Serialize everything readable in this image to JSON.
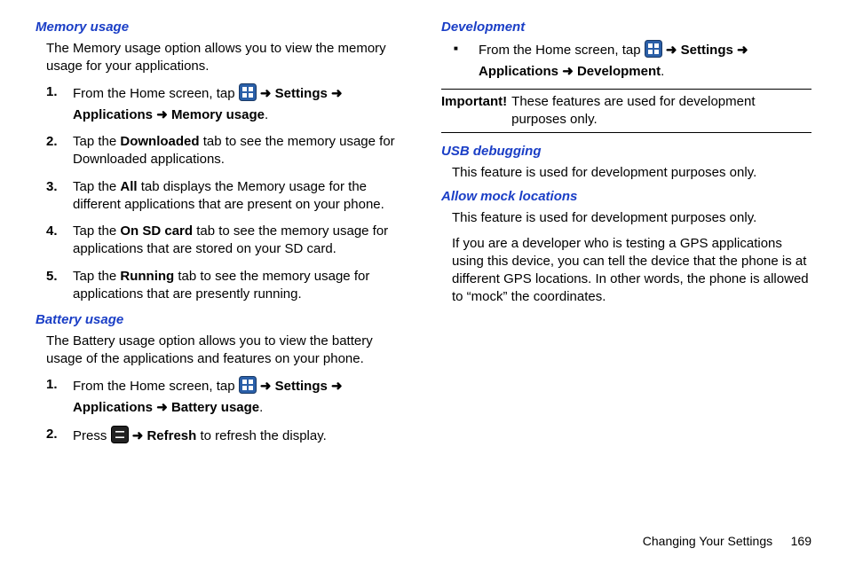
{
  "left": {
    "memory": {
      "heading": "Memory usage",
      "intro": "The Memory usage option allows you to view the memory usage for your applications.",
      "steps": {
        "s1_pre": "From the Home screen, tap ",
        "s1_path1": "Settings",
        "s1_path2": "Applications",
        "s1_path3": "Memory usage",
        "s2a": "Tap the ",
        "s2b": "Downloaded",
        "s2c": " tab to see the memory usage for Downloaded applications.",
        "s3a": "Tap the ",
        "s3b": "All",
        "s3c": " tab displays the Memory usage for the different applications that are present on your phone.",
        "s4a": "Tap the ",
        "s4b": "On SD card",
        "s4c": " tab to see the memory usage for applications that are stored on your SD card.",
        "s5a": "Tap the ",
        "s5b": "Running",
        "s5c": " tab to see the memory usage for applications that are presently running."
      }
    },
    "battery": {
      "heading": "Battery usage",
      "intro": "The Battery usage option allows you to view the battery usage of the applications and features on your phone.",
      "steps": {
        "s1_pre": "From the Home screen, tap ",
        "s1_path1": "Settings",
        "s1_path2": "Applications",
        "s1_path3": "Battery usage",
        "s2a": "Press ",
        "s2b": "Refresh",
        "s2c": " to refresh the display."
      }
    }
  },
  "right": {
    "dev": {
      "heading": "Development",
      "bullet_pre": "From the Home screen, tap ",
      "path1": "Settings",
      "path2": "Applications",
      "path3": "Development",
      "important_label": "Important!",
      "important_text": "These features are used for development purposes only."
    },
    "usb": {
      "heading": "USB debugging",
      "body": "This feature is used for development purposes only."
    },
    "mock": {
      "heading": "Allow mock locations",
      "p1": "This feature is used for development purposes only.",
      "p2": "If you are a developer who is testing a GPS applications using this device, you can tell the device that the phone is at different GPS locations. In other words, the phone is allowed to “mock” the coordinates."
    }
  },
  "arrow": "➜",
  "footer": {
    "section": "Changing Your Settings",
    "page": "169"
  }
}
